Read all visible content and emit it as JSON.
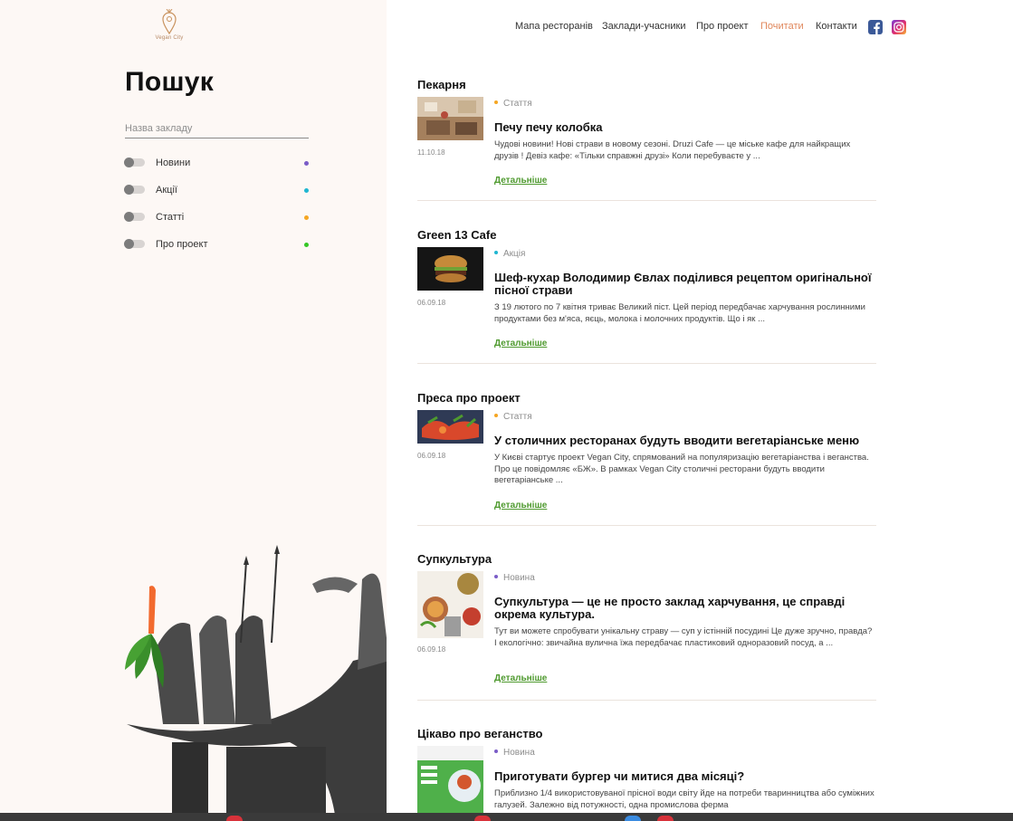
{
  "brand": {
    "name": "Vegan City"
  },
  "nav": {
    "items": [
      "Мапа ресторанів",
      "Заклади-учасники",
      "Про проект",
      "Почитати",
      "Контакти"
    ],
    "active": "Почитати",
    "social": [
      "facebook-icon",
      "instagram-icon"
    ]
  },
  "search": {
    "title": "Пошук",
    "placeholder": "Назва закладу"
  },
  "filters": [
    {
      "label": "Новини",
      "color": "#7a5cc7"
    },
    {
      "label": "Акції",
      "color": "#1fb6d1"
    },
    {
      "label": "Статті",
      "color": "#f5a623"
    },
    {
      "label": "Про проект",
      "color": "#36c726"
    }
  ],
  "colors": {
    "accent": "#e0875c",
    "link": "#4f9a2f",
    "panel": "#fdf8f5"
  },
  "posts": [
    {
      "category": "Пекарня",
      "date": "11.10.18",
      "tag": "Стаття",
      "tag_color": "#f5a623",
      "title": "Печу печу колобка",
      "excerpt": "Чудові новини! Нові страви в новому сезоні. Druzi Cafe — це міське кафе для найкращих друзів ! Девіз кафе: «Тільки справжні друзі» Коли перебуваєте у ...",
      "more": "Детальніше"
    },
    {
      "category": "Green 13 Cafe",
      "date": "06.09.18",
      "tag": "Акція",
      "tag_color": "#1fb6d1",
      "title": "Шеф-кухар Володимир Євлах поділився рецептом оригінальної пісної страви",
      "excerpt": "З 19 лютого по 7 квітня триває Великий піст. Цей період передбачає харчування рослинними продуктами без м'яса, яєць, молока і молочних продуктів. Що і як ...",
      "more": "Детальніше"
    },
    {
      "category": "Преса про проект",
      "date": "06.09.18",
      "tag": "Стаття",
      "tag_color": "#f5a623",
      "title": "У столичних ресторанах будуть вводити вегетаріанське меню",
      "excerpt": "У Києві стартує проект Vegan City, спрямований на популяризацію вегетаріанства і веганства. Про це повідомляє «БЖ». В рамках Vegan City столичні ресторани будуть вводити вегетаріанське ...",
      "more": "Детальніше"
    },
    {
      "category": "Супкультура",
      "date": "06.09.18",
      "tag": "Новина",
      "tag_color": "#7a5cc7",
      "title": "Супкультура — це не просто заклад харчування, це справді окрема культура.",
      "excerpt": "Тут ви можете спробувати унікальну страву — суп у істінній посудині Це дуже зручно, правда? І екологічно: звичайна вулична їжа передбачає пластиковий одноразовий посуд, а ...",
      "more": "Детальніше"
    },
    {
      "category": "Цікаво про веганство",
      "date": "",
      "tag": "Новина",
      "tag_color": "#7a5cc7",
      "title": "Приготувати бургер чи митися два місяці?",
      "excerpt": "Приблизно 1/4 використовуваної прісної води світу йде на потреби тваринництва або суміжних галузей. Залежно від потужності, одна промислова ферма",
      "more": ""
    }
  ]
}
